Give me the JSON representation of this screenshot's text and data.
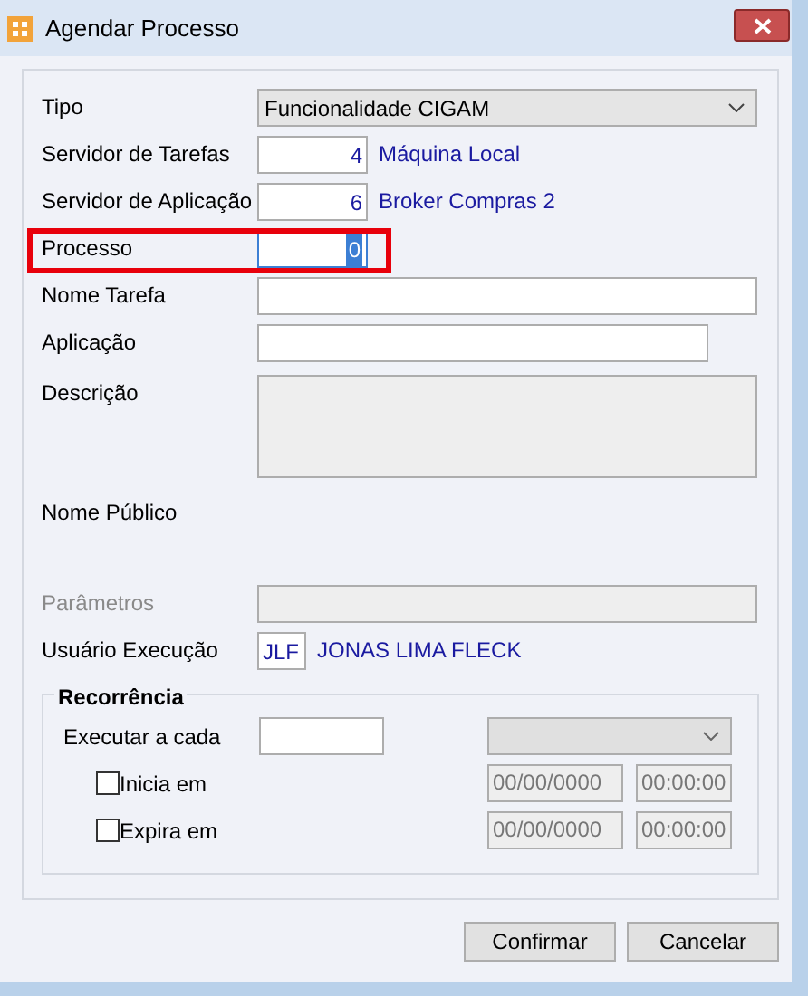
{
  "window": {
    "title": "Agendar Processo"
  },
  "fields": [
    {
      "kind": "dropdown",
      "label": "Tipo",
      "value": "Funcionalidade CIGAM",
      "disabled": false,
      "readonly": false
    },
    {
      "kind": "code",
      "label": "Servidor de Tarefas",
      "value": "4",
      "description": "Máquina Local",
      "focused": false,
      "highlighted": false,
      "disabled": false,
      "readonly": false
    },
    {
      "kind": "code",
      "label": "Servidor de Aplicação",
      "value": "6",
      "description": "Broker Compras 2",
      "focused": false,
      "highlighted": false,
      "disabled": false,
      "readonly": false
    },
    {
      "kind": "code",
      "label": "Processo",
      "value": "0",
      "focused": true,
      "highlighted": true,
      "disabled": false,
      "readonly": false
    },
    {
      "kind": "text",
      "label": "Nome Tarefa",
      "disabled": false,
      "readonly": false
    },
    {
      "kind": "text",
      "label": "Aplicação",
      "disabled": false,
      "readonly": false
    },
    {
      "kind": "memo",
      "label": "Descrição",
      "disabled": false,
      "readonly": true
    },
    {
      "kind": "label",
      "label": "Nome Público",
      "disabled": false,
      "readonly": false
    },
    {
      "kind": "text",
      "label": "Parâmetros",
      "disabled": true,
      "readonly": false
    },
    {
      "kind": "user",
      "label": "Usuário Execução",
      "value": "JLF",
      "description": "JONAS LIMA FLECK",
      "disabled": false,
      "readonly": false
    }
  ],
  "recurrence": {
    "title": "Recorrência",
    "interval_label": "Executar a cada",
    "unit_disabled": true,
    "schedules": [
      {
        "label": "Inicia em",
        "checked": false,
        "date": "00/00/0000",
        "time": "00:00:00"
      },
      {
        "label": "Expira em",
        "checked": false,
        "date": "00/00/0000",
        "time": "00:00:00"
      }
    ]
  },
  "buttons": [
    {
      "label": "Confirmar"
    },
    {
      "label": "Cancelar"
    }
  ]
}
